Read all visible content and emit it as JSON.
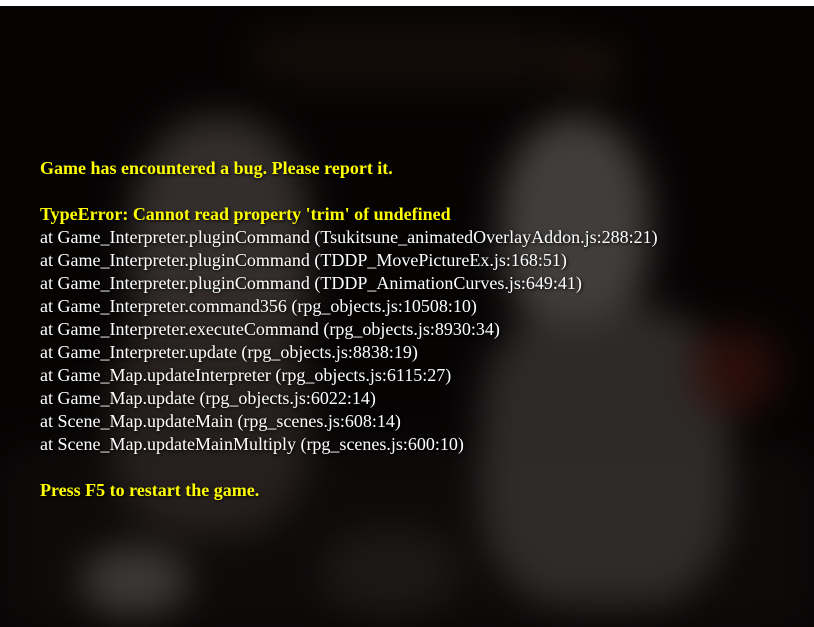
{
  "error_screen": {
    "heading": "Game has encountered a bug. Please report it.",
    "error_type": "TypeError: Cannot read property 'trim' of undefined",
    "stack": [
      "at Game_Interpreter.pluginCommand (Tsukitsune_animatedOverlayAddon.js:288:21)",
      "at Game_Interpreter.pluginCommand (TDDP_MovePictureEx.js:168:51)",
      "at Game_Interpreter.pluginCommand (TDDP_AnimationCurves.js:649:41)",
      "at Game_Interpreter.command356 (rpg_objects.js:10508:10)",
      "at Game_Interpreter.executeCommand (rpg_objects.js:8930:34)",
      "at Game_Interpreter.update (rpg_objects.js:8838:19)",
      "at Game_Map.updateInterpreter (rpg_objects.js:6115:27)",
      "at Game_Map.update (rpg_objects.js:6022:14)",
      "at Scene_Map.updateMain (rpg_scenes.js:608:14)",
      "at Scene_Map.updateMainMultiply (rpg_scenes.js:600:10)"
    ],
    "restart_hint": "Press F5 to restart the game."
  },
  "colors": {
    "highlight_text": "#ffff00",
    "body_text": "#ffffff",
    "background": "#0b0807"
  }
}
